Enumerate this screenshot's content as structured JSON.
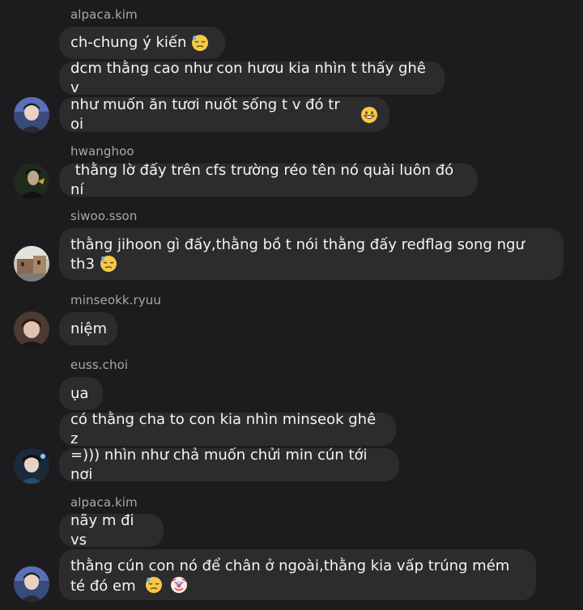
{
  "groups": [
    {
      "username": "alpaca.kim",
      "messages": [
        {
          "text": "ch-chung ý kiến",
          "emoji": [
            "downcast-sweat-face-icon"
          ]
        },
        {
          "text": "dcm thằng cao như con hươu kia nhìn t thấy ghê v",
          "emoji": []
        },
        {
          "text": "như muốn ăn tươi nuốt sống t v đó tr oi",
          "emoji": [
            "grinning-face-icon"
          ]
        }
      ]
    },
    {
      "username": "hwanghoo",
      "messages": [
        {
          "text": " thằng lờ đấy trên cfs trường réo tên nó quài luôn đó ní",
          "emoji": []
        }
      ]
    },
    {
      "username": "siwoo.sson",
      "messages": [
        {
          "text": "thằng jihoon gì đấy,thằng bồ t nói thằng đấy redflag song ngư th3",
          "emoji": [
            "downcast-sweat-face-icon"
          ]
        }
      ]
    },
    {
      "username": "minseokk.ryuu",
      "messages": [
        {
          "text": "niệm",
          "emoji": []
        }
      ]
    },
    {
      "username": "euss.choi",
      "messages": [
        {
          "text": "ụa",
          "emoji": []
        },
        {
          "text": "có thằng cha to con kia nhìn minseok ghê z",
          "emoji": []
        },
        {
          "text": "=))) nhìn như chả muốn chửi min cún tới nơi",
          "emoji": []
        }
      ]
    },
    {
      "username": "alpaca.kim",
      "messages": [
        {
          "text": "nãy m đi vs",
          "emoji": []
        },
        {
          "text": "thằng cún con nó để chân ở ngoài,thằng kia vấp trúng mém té đó em",
          "emoji": [
            "downcast-sweat-face-icon",
            "clown-face-icon"
          ]
        }
      ]
    }
  ]
}
